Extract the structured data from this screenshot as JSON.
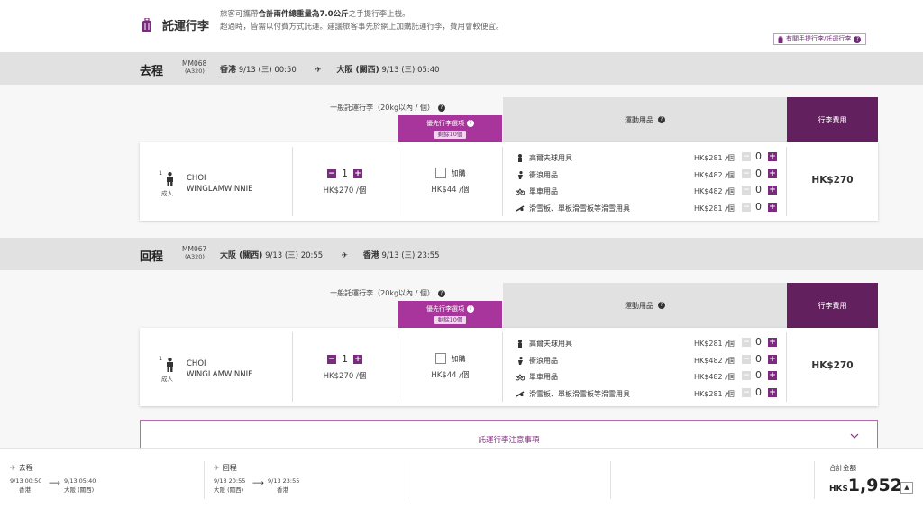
{
  "header": {
    "title": "託運行李",
    "desc_line1_pre": "旅客可攜帶",
    "desc_line1_bold": "合計兩件總重量為7.0公斤",
    "desc_line1_post": "之手提行李上機。",
    "desc_line2": "超過時，皆需以付費方式託運。建議旅客事先於網上加購託運行李，費用會較便宜。",
    "info_link": "有關手提行李/託運行李",
    "brand_color": "#63205f"
  },
  "table_headers": {
    "normal_baggage": "一般託運行李（20kg以內 / 個）",
    "priority": "優先行李選項",
    "remaining": "剩餘10個",
    "sports": "運動用品",
    "fee": "行李費用"
  },
  "outbound": {
    "direction": "去程",
    "flight_no": "MM068",
    "aircraft": "(A320)",
    "from_city": "香港",
    "from_time": "9/13 (三) 00:50",
    "to_city": "大阪 (關西)",
    "to_time": "9/13 (三) 05:40"
  },
  "return": {
    "direction": "回程",
    "flight_no": "MM067",
    "aircraft": "(A320)",
    "from_city": "大阪 (關西)",
    "from_time": "9/13 (三) 20:55",
    "to_city": "香港",
    "to_time": "9/13 (三) 23:55"
  },
  "passenger": {
    "index": "1",
    "type": "成人",
    "name_line1": "CHOI",
    "name_line2": "WINGLAMWINNIE"
  },
  "baggage": {
    "qty": "1",
    "unit_price": "HK$270 /個",
    "priority_label": "加購",
    "priority_price": "HK$44 /個",
    "fee": "HK$270"
  },
  "sports_items": [
    {
      "name": "高爾夫球用具",
      "price": "HK$281 /個",
      "count": "0",
      "icon": "golf-icon"
    },
    {
      "name": "衝浪用品",
      "price": "HK$482 /個",
      "count": "0",
      "icon": "surf-icon"
    },
    {
      "name": "單車用品",
      "price": "HK$482 /個",
      "count": "0",
      "icon": "bicycle-icon"
    },
    {
      "name": "滑雪板、單板滑雪板等滑雪用具",
      "price": "HK$281 /個",
      "count": "0",
      "icon": "ski-icon"
    }
  ],
  "notice": {
    "label": "託運行李注意事項"
  },
  "footer": {
    "out_label": "去程",
    "out_dep_time": "9/13 00:50",
    "out_dep_city": "香港",
    "out_arr_time": "9/13 05:40",
    "out_arr_city": "大阪 (關西)",
    "ret_label": "回程",
    "ret_dep_time": "9/13 20:55",
    "ret_dep_city": "大阪 (關西)",
    "ret_arr_time": "9/13 23:55",
    "ret_arr_city": "香港",
    "total_label": "合計金額",
    "currency": "HK$",
    "total": "1,952"
  }
}
